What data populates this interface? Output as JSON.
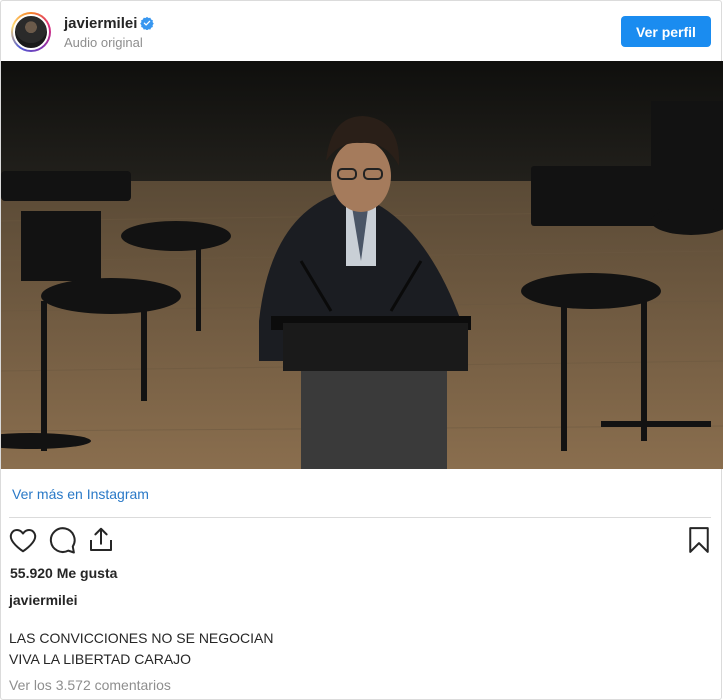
{
  "header": {
    "username": "javiermilei",
    "subtitle": "Audio original",
    "profile_button": "Ver perfil",
    "verified_icon": "verified-badge-icon"
  },
  "media": {
    "description_icon": "video-frame"
  },
  "more_link": "Ver más en Instagram",
  "actions": {
    "like_icon": "heart-icon",
    "comment_icon": "comment-icon",
    "share_icon": "share-icon",
    "save_icon": "bookmark-icon"
  },
  "likes": "55.920 Me gusta",
  "caption": {
    "user": "javiermilei",
    "lines": [
      "LAS CONVICCIONES NO SE NEGOCIAN",
      "VIVA LA LIBERTAD CARAJO"
    ]
  },
  "comments_link": "Ver los 3.572 comentarios",
  "colors": {
    "primary_button": "#1a8cf0",
    "link": "#2a79c7",
    "muted": "#8e8e8e",
    "verified": "#3897f0"
  }
}
